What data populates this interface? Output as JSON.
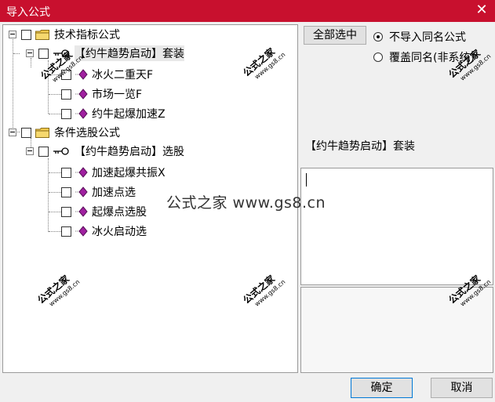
{
  "window": {
    "title": "导入公式",
    "close_glyph": "✕"
  },
  "tree": {
    "groups": [
      {
        "label": "技术指标公式",
        "suite": "【约牛趋势启动】套装",
        "items": [
          "冰火二重天F",
          "市场一览F",
          "约牛起爆加速Z"
        ]
      },
      {
        "label": "条件选股公式",
        "suite": "【约牛趋势启动】选股",
        "items": [
          "加速起爆共振X",
          "加速点选",
          "起爆点选股",
          "冰火启动选"
        ]
      }
    ]
  },
  "controls": {
    "select_all": "全部选中",
    "radio_skip": "不导入同名公式",
    "radio_overwrite": "覆盖同名(非系统)",
    "radio_selected": "skip"
  },
  "details": {
    "selected_name": "【约牛趋势启动】套装"
  },
  "footer": {
    "ok": "确定",
    "cancel": "取消"
  },
  "watermark": {
    "brand": "公式之家",
    "site": "www.gs8.cn",
    "center_text": "公式之家 www.gs8.cn"
  },
  "colors": {
    "title_bar": "#c8102e",
    "gem": "#a020a0",
    "folder": "#f2c94c"
  }
}
